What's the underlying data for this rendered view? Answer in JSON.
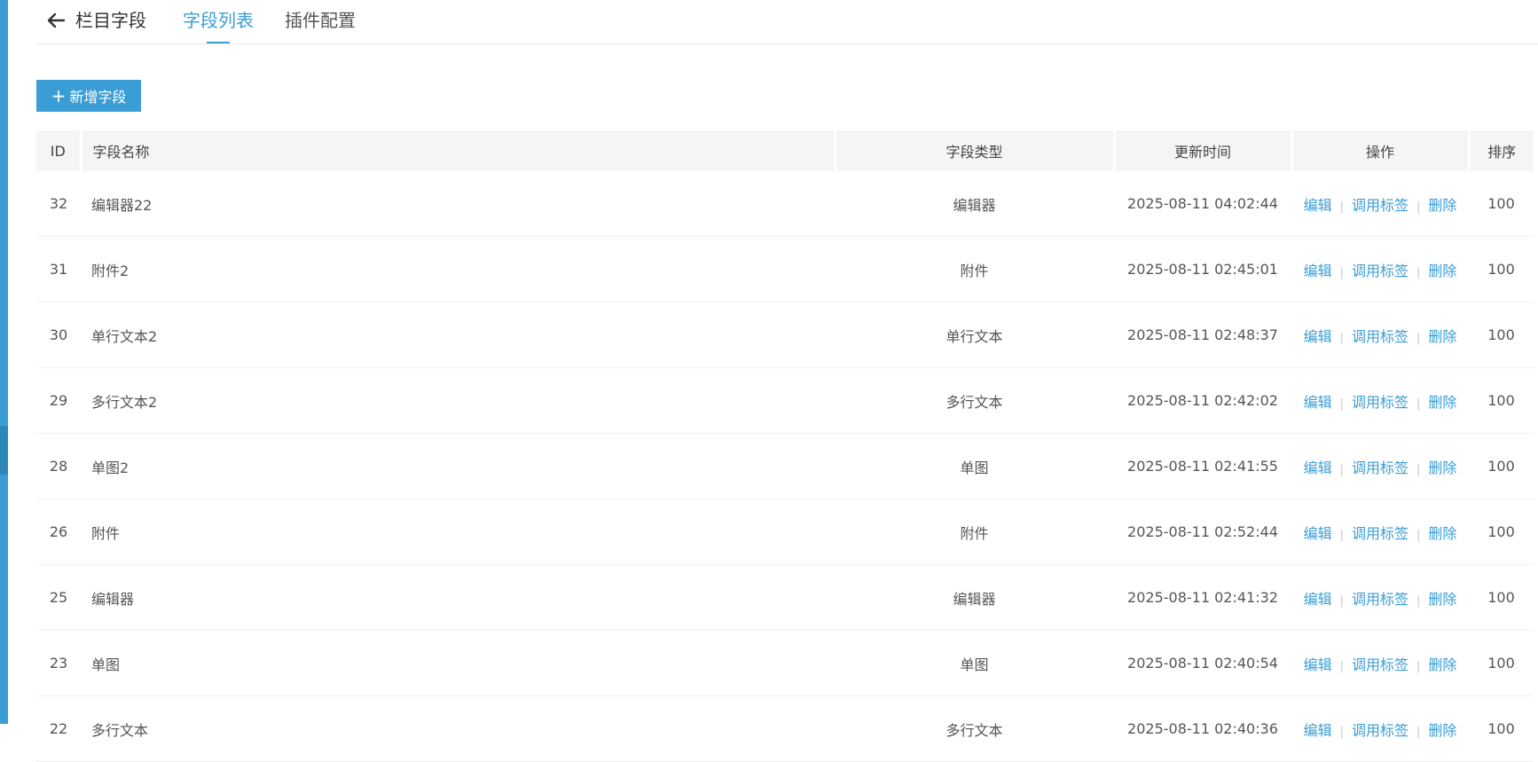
{
  "header": {
    "back_icon": "arrow-left-icon",
    "title": "栏目字段",
    "tabs": [
      {
        "label": "字段列表",
        "active": true
      },
      {
        "label": "插件配置",
        "active": false
      }
    ]
  },
  "toolbar": {
    "add_label": "新增字段",
    "add_icon": "plus-icon"
  },
  "table": {
    "columns": [
      "ID",
      "字段名称",
      "字段类型",
      "更新时间",
      "操作",
      "排序"
    ],
    "actions": [
      "编辑",
      "调用标签",
      "删除"
    ],
    "rows": [
      {
        "id": "32",
        "name": "编辑器22",
        "type": "编辑器",
        "time": "2025-08-11 04:02:44",
        "sort": "100"
      },
      {
        "id": "31",
        "name": "附件2",
        "type": "附件",
        "time": "2025-08-11 02:45:01",
        "sort": "100"
      },
      {
        "id": "30",
        "name": "单行文本2",
        "type": "单行文本",
        "time": "2025-08-11 02:48:37",
        "sort": "100"
      },
      {
        "id": "29",
        "name": "多行文本2",
        "type": "多行文本",
        "time": "2025-08-11 02:42:02",
        "sort": "100"
      },
      {
        "id": "28",
        "name": "单图2",
        "type": "单图",
        "time": "2025-08-11 02:41:55",
        "sort": "100"
      },
      {
        "id": "26",
        "name": "附件",
        "type": "附件",
        "time": "2025-08-11 02:52:44",
        "sort": "100"
      },
      {
        "id": "25",
        "name": "编辑器",
        "type": "编辑器",
        "time": "2025-08-11 02:41:32",
        "sort": "100"
      },
      {
        "id": "23",
        "name": "单图",
        "type": "单图",
        "time": "2025-08-11 02:40:54",
        "sort": "100"
      },
      {
        "id": "22",
        "name": "多行文本",
        "type": "多行文本",
        "time": "2025-08-11 02:40:36",
        "sort": "100"
      }
    ]
  },
  "colors": {
    "accent": "#3a9dd6",
    "sidebar": "#3a9dd6",
    "header_bg": "#f5f5f5"
  }
}
